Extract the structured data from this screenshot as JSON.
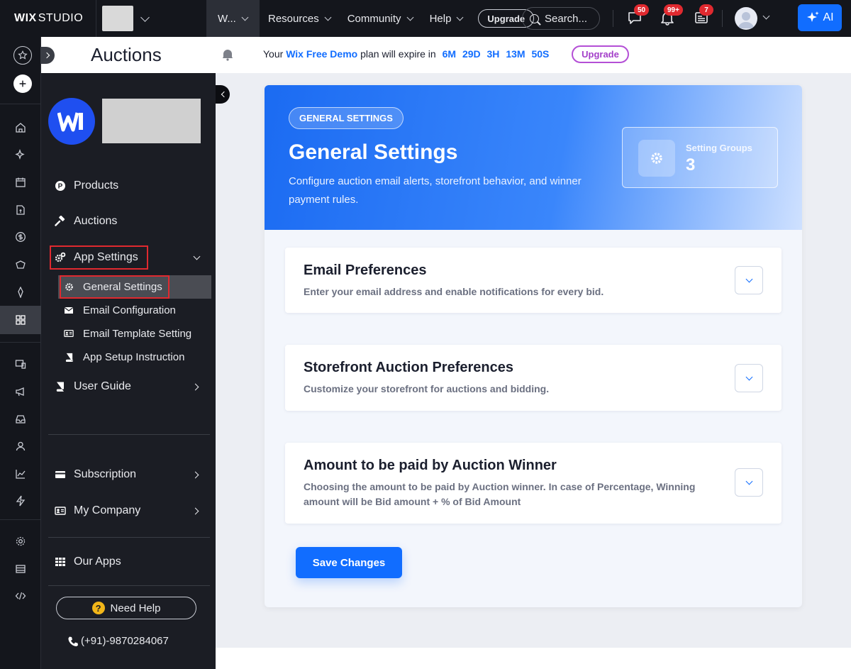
{
  "topbar": {
    "brand_bold": "WIX",
    "brand_light": "STUDIO",
    "site_short": "W...",
    "menu": [
      "Resources",
      "Community",
      "Help"
    ],
    "upgrade_label": "Upgrade",
    "search_placeholder": "Search...",
    "badges": {
      "messages": "50",
      "notifications": "99+",
      "inbox": "7"
    },
    "ai_label": "AI"
  },
  "page": {
    "title": "Auctions",
    "plan_prefix": "Your",
    "plan_name": "Wix Free Demo",
    "plan_mid": "plan will expire in",
    "countdown": [
      "6M",
      "29D",
      "3H",
      "13M",
      "50S"
    ],
    "upgrade_label": "Upgrade"
  },
  "sidebar": {
    "logo_letter": "W",
    "items": {
      "products": "Products",
      "auctions": "Auctions",
      "app_settings": "App Settings",
      "general_settings": "General Settings",
      "email_configuration": "Email Configuration",
      "email_template_setting": "Email Template Setting",
      "app_setup_instruction": "App Setup Instruction",
      "user_guide": "User Guide",
      "subscription": "Subscription",
      "my_company": "My Company",
      "our_apps": "Our Apps"
    },
    "need_help": "Need Help",
    "phone": "(+91)-9870284067"
  },
  "hero": {
    "tag": "GENERAL SETTINGS",
    "title": "General Settings",
    "description": "Configure auction email alerts, storefront behavior, and winner payment rules.",
    "card_label": "Setting Groups",
    "card_value": "3"
  },
  "sections": [
    {
      "title": "Email Preferences",
      "description": "Enter your email address and enable notifications for every bid."
    },
    {
      "title": "Storefront Auction Preferences",
      "description": "Customize your storefront for auctions and bidding."
    },
    {
      "title": "Amount to be paid by Auction Winner",
      "description": "Choosing the amount to be paid by Auction winner. In case of Percentage, Winning amount will be Bid amount + % of Bid Amount"
    }
  ],
  "save_label": "Save Changes",
  "colors": {
    "accent": "#116dff",
    "highlight": "#e0292f",
    "sidebar_bg": "#1b1d24",
    "topbar_bg": "#14161c"
  }
}
